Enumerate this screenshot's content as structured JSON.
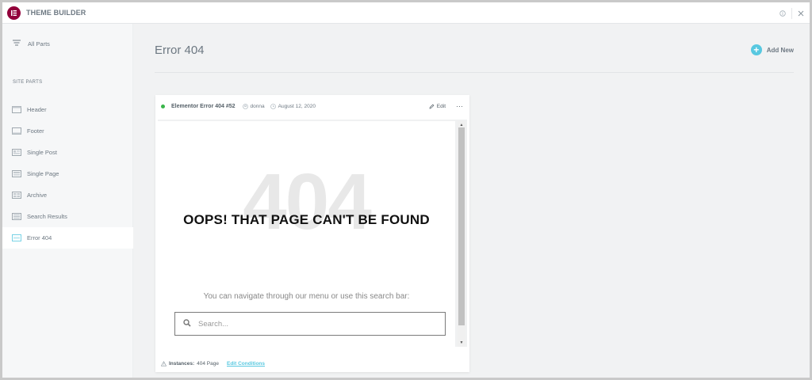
{
  "app": {
    "title": "THEME BUILDER"
  },
  "sidebar": {
    "all_parts_label": "All Parts",
    "section_label": "SITE PARTS",
    "items": [
      {
        "label": "Header",
        "icon": "header-layout-icon"
      },
      {
        "label": "Footer",
        "icon": "footer-layout-icon"
      },
      {
        "label": "Single Post",
        "icon": "single-post-layout-icon"
      },
      {
        "label": "Single Page",
        "icon": "single-page-layout-icon"
      },
      {
        "label": "Archive",
        "icon": "archive-layout-icon"
      },
      {
        "label": "Search Results",
        "icon": "search-results-layout-icon"
      },
      {
        "label": "Error 404",
        "icon": "error-404-layout-icon",
        "active": true
      }
    ]
  },
  "main": {
    "page_title": "Error 404",
    "add_new_label": "Add New"
  },
  "card": {
    "status_color": "#39b54a",
    "title": "Elementor Error 404 #52",
    "author": "donna",
    "date": "August 12, 2020",
    "edit_label": "Edit",
    "more_label": "···",
    "preview": {
      "big_number": "404",
      "headline": "OOPS! THAT PAGE CAN'T BE FOUND",
      "nav_text": "You can navigate through our menu or use this search bar:",
      "search_placeholder": "Search..."
    },
    "footer": {
      "instances_label": "Instances:",
      "instances_value": "404 Page",
      "edit_conditions_label": "Edit Conditions"
    }
  },
  "colors": {
    "brand": "#92003b",
    "accent": "#58c8e0"
  }
}
